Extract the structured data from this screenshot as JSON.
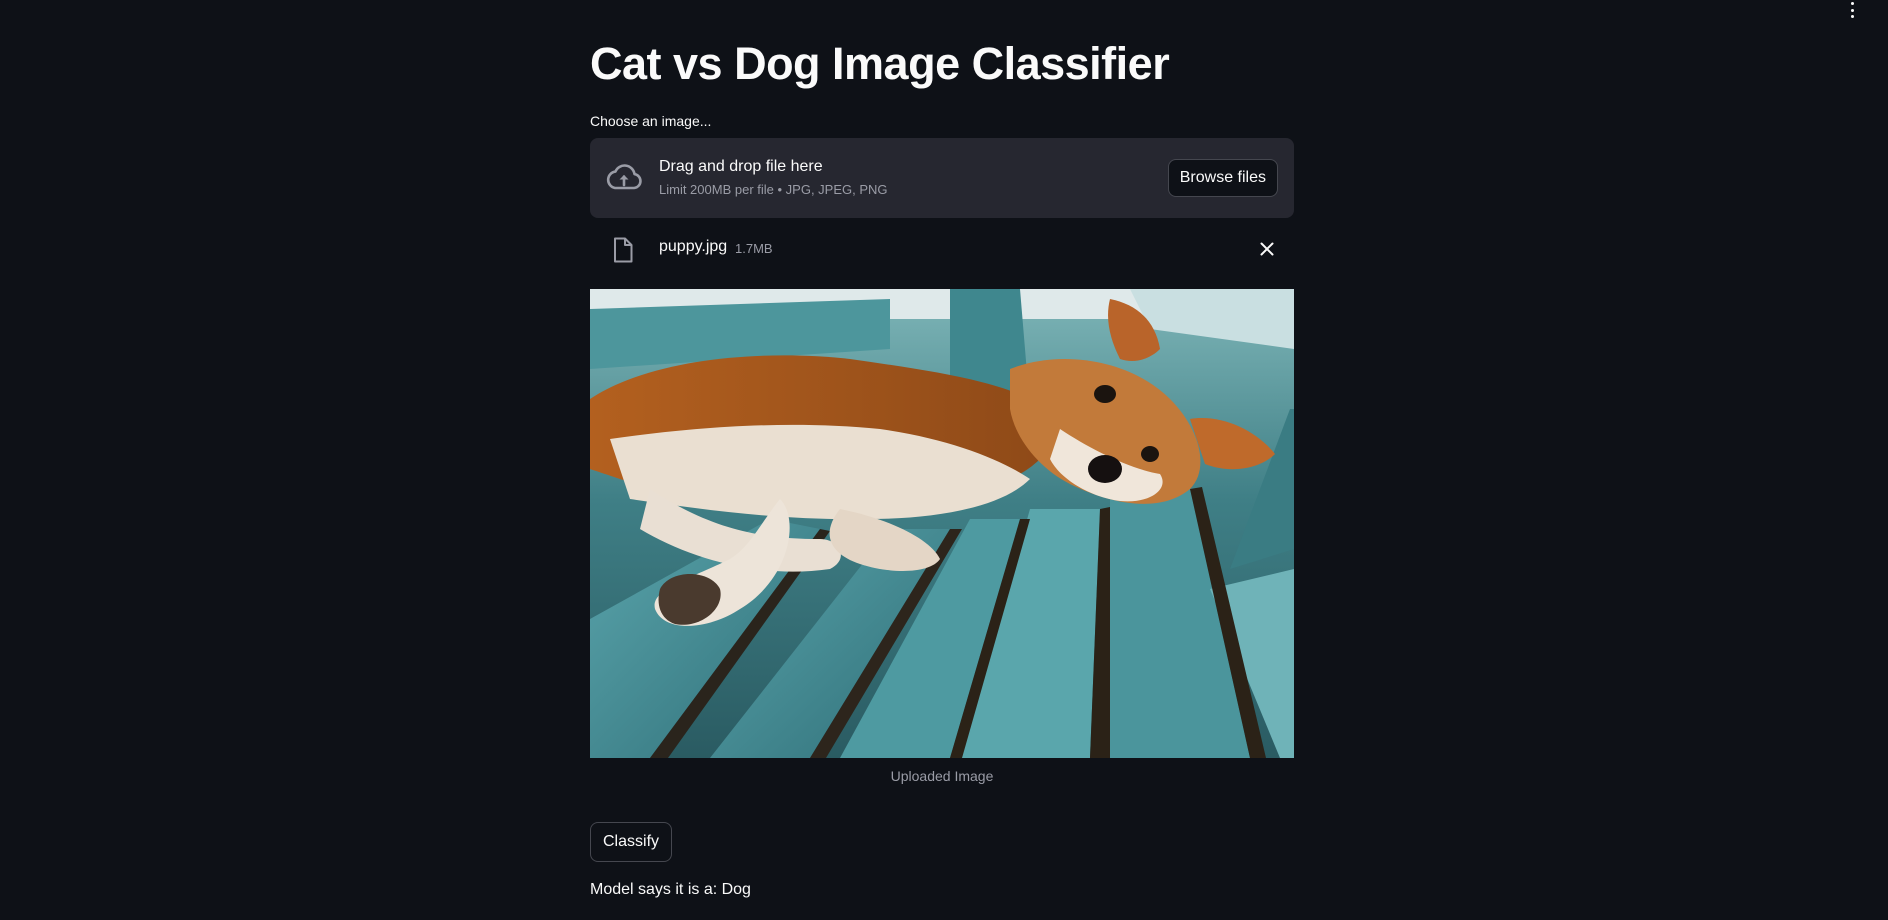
{
  "page": {
    "title": "Cat vs Dog Image Classifier"
  },
  "uploader": {
    "label": "Choose an image...",
    "drop_text": "Drag and drop file here",
    "limit_text": "Limit 200MB per file • JPG, JPEG, PNG",
    "browse_label": "Browse files"
  },
  "uploaded_file": {
    "name": "puppy.jpg",
    "size": "1.7MB"
  },
  "image": {
    "caption": "Uploaded Image"
  },
  "actions": {
    "classify_label": "Classify"
  },
  "result": {
    "text": "Model says it is a: Dog"
  },
  "icons": {
    "menu": "more-vertical-icon",
    "upload": "cloud-upload-icon",
    "file": "file-icon",
    "close": "close-icon"
  },
  "colors": {
    "background": "#0e1117",
    "dropzone": "#262730",
    "text": "#fafafa",
    "muted": "#9a9ca6",
    "border": "#45474f"
  }
}
